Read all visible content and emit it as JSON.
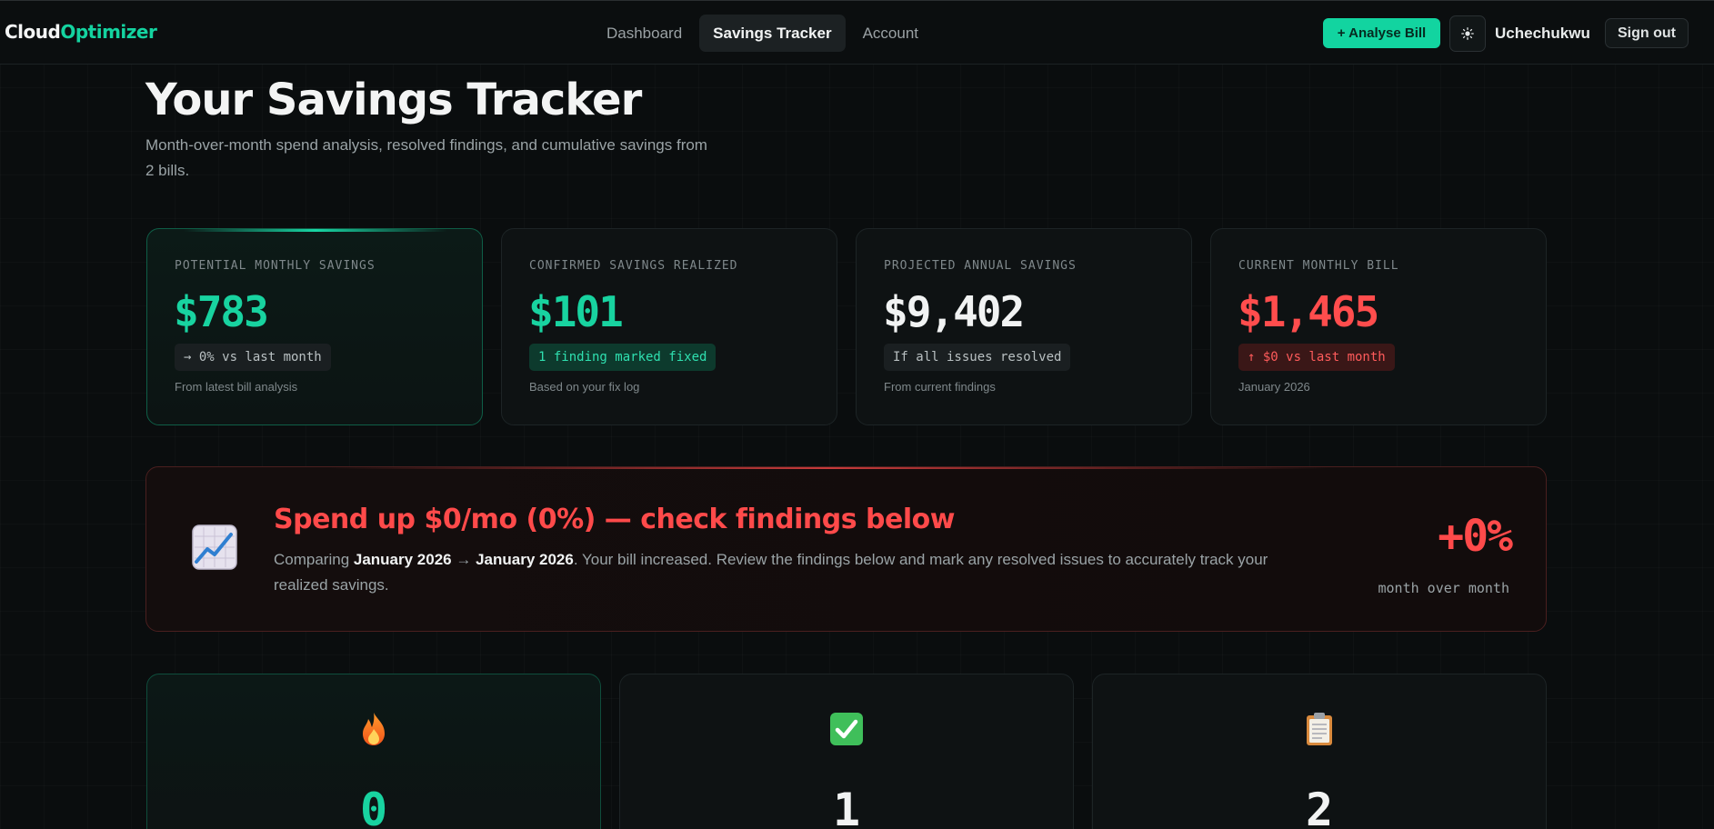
{
  "brand": {
    "part1": "Cloud",
    "part2": "Optimizer"
  },
  "nav": {
    "links": [
      {
        "label": "Dashboard",
        "active": false
      },
      {
        "label": "Savings Tracker",
        "active": true
      },
      {
        "label": "Account",
        "active": false
      }
    ],
    "analyse_label": "+ Analyse Bill",
    "theme_icon": "☀",
    "user_name": "Uchechukwu",
    "signout_label": "Sign out"
  },
  "hero": {
    "title": "Your Savings Tracker",
    "subtitle": "Month-over-month spend analysis, resolved findings, and cumulative savings from 2 bills."
  },
  "stats": [
    {
      "label": "POTENTIAL MONTHLY SAVINGS",
      "value": "$783",
      "pill": "→ 0% vs last month",
      "foot": "From latest bill analysis"
    },
    {
      "label": "CONFIRMED SAVINGS REALIZED",
      "value": "$101",
      "pill": "1 finding marked fixed",
      "foot": "Based on your fix log"
    },
    {
      "label": "PROJECTED ANNUAL SAVINGS",
      "value": "$9,402",
      "pill": "If all issues resolved",
      "foot": "From current findings"
    },
    {
      "label": "CURRENT MONTHLY BILL",
      "value": "$1,465",
      "pill": "↑ $0 vs last month",
      "foot": "January 2026"
    }
  ],
  "alert": {
    "title": "Spend up $0/mo (0%) — check findings below",
    "body_prefix": "Comparing ",
    "from_month": "January 2026",
    "arrow": " → ",
    "to_month": "January 2026",
    "body_suffix": ". Your bill increased. Review the findings below and mark any resolved issues to accurately track your realized savings.",
    "pct": "+0%",
    "pct_label": "month over month"
  },
  "counts": [
    {
      "icon": "fire-icon",
      "value": "0"
    },
    {
      "icon": "check-icon",
      "value": "1"
    },
    {
      "icon": "clipboard-icon",
      "value": "2"
    }
  ],
  "colors": {
    "accent": "#12d4a0",
    "danger": "#ff4a4a"
  }
}
